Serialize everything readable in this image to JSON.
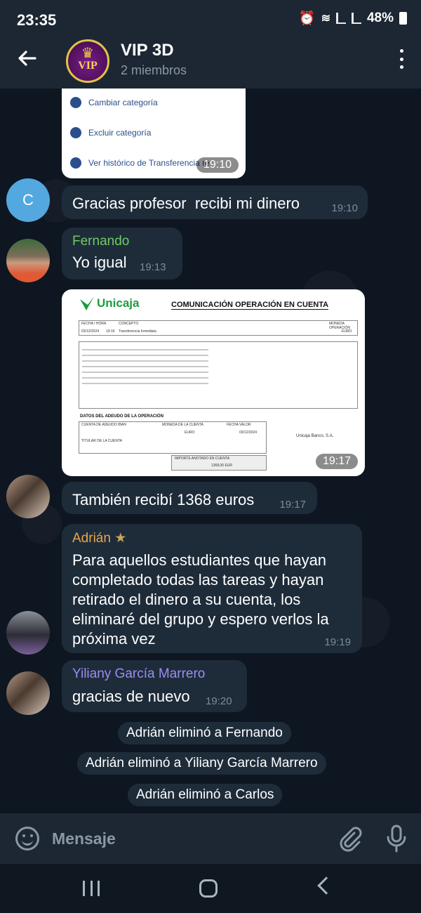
{
  "status": {
    "time": "23:35",
    "battery": "48%"
  },
  "header": {
    "title": "VIP 3D",
    "subtitle": "2 miembros",
    "avatar_text": "VIP",
    "avatar_crown": "♛"
  },
  "screenshot_card": {
    "items": [
      "Cambiar categoría",
      "Excluir categoría",
      "Ver histórico de Transferencia re"
    ],
    "time": "19:10"
  },
  "messages": [
    {
      "avatar_letter": "C",
      "text": "Gracias profesor  recibi mi dinero",
      "time": "19:10"
    },
    {
      "sender": "Fernando",
      "text": "Yo igual",
      "time": "19:13"
    },
    {
      "time": "19:17"
    },
    {
      "text": "También recibí 1368 euros",
      "time": "19:17"
    },
    {
      "sender": "Adrián",
      "sender_badge": "★",
      "text": "Para aquellos estudiantes que hayan completado todas las tareas y hayan retirado el dinero a su cuenta, los eliminaré del grupo y espero verlos la próxima vez",
      "time": "19:19"
    },
    {
      "sender": "Yiliany García Marrero",
      "text": "gracias de nuevo",
      "time": "19:20"
    }
  ],
  "receipt": {
    "bank": "Unicaja",
    "title": "COMUNICACIÓN OPERACIÓN EN CUENTA",
    "fecha_hora_label": "FECHA / HORA",
    "fecha": "03/12/2024",
    "hora": "19:16",
    "concepto_label": "CONCEPTO",
    "concepto": "Transferencia Inmediata",
    "moneda_label": "MONEDA OPERACIÓN",
    "moneda": "EURO",
    "datos_label": "DATOS DEL ADEUDO DE LA OPERACIÓN",
    "cuenta_label": "CUENTA DE ADEUDO IBAN",
    "moneda_cuenta_label": "MONEDA DE LA CUENTA",
    "moneda_cuenta": "EURO",
    "fecha_valor_label": "FECHA VALOR",
    "fecha_valor": "03/12/2024",
    "titular_label": "TITULAR DE LA CUENTA",
    "importe_label": "IMPORTE ANOTADO EN CUENTA",
    "importe": "1368,00 EUR",
    "footer": "Unicaja Banco, S.A."
  },
  "system_messages": [
    "Adrián eliminó a Fernando",
    "Adrián eliminó a Yiliany García Marrero",
    "Adrián eliminó a Carlos"
  ],
  "input": {
    "placeholder": "Mensaje"
  },
  "colors": {
    "background": "#0e1621",
    "bubble": "#1e2c3a",
    "fernando": "#6ecb63",
    "adrian": "#e8a648",
    "yiliany": "#9a8ef0",
    "avatar_c": "#54a8e0"
  }
}
